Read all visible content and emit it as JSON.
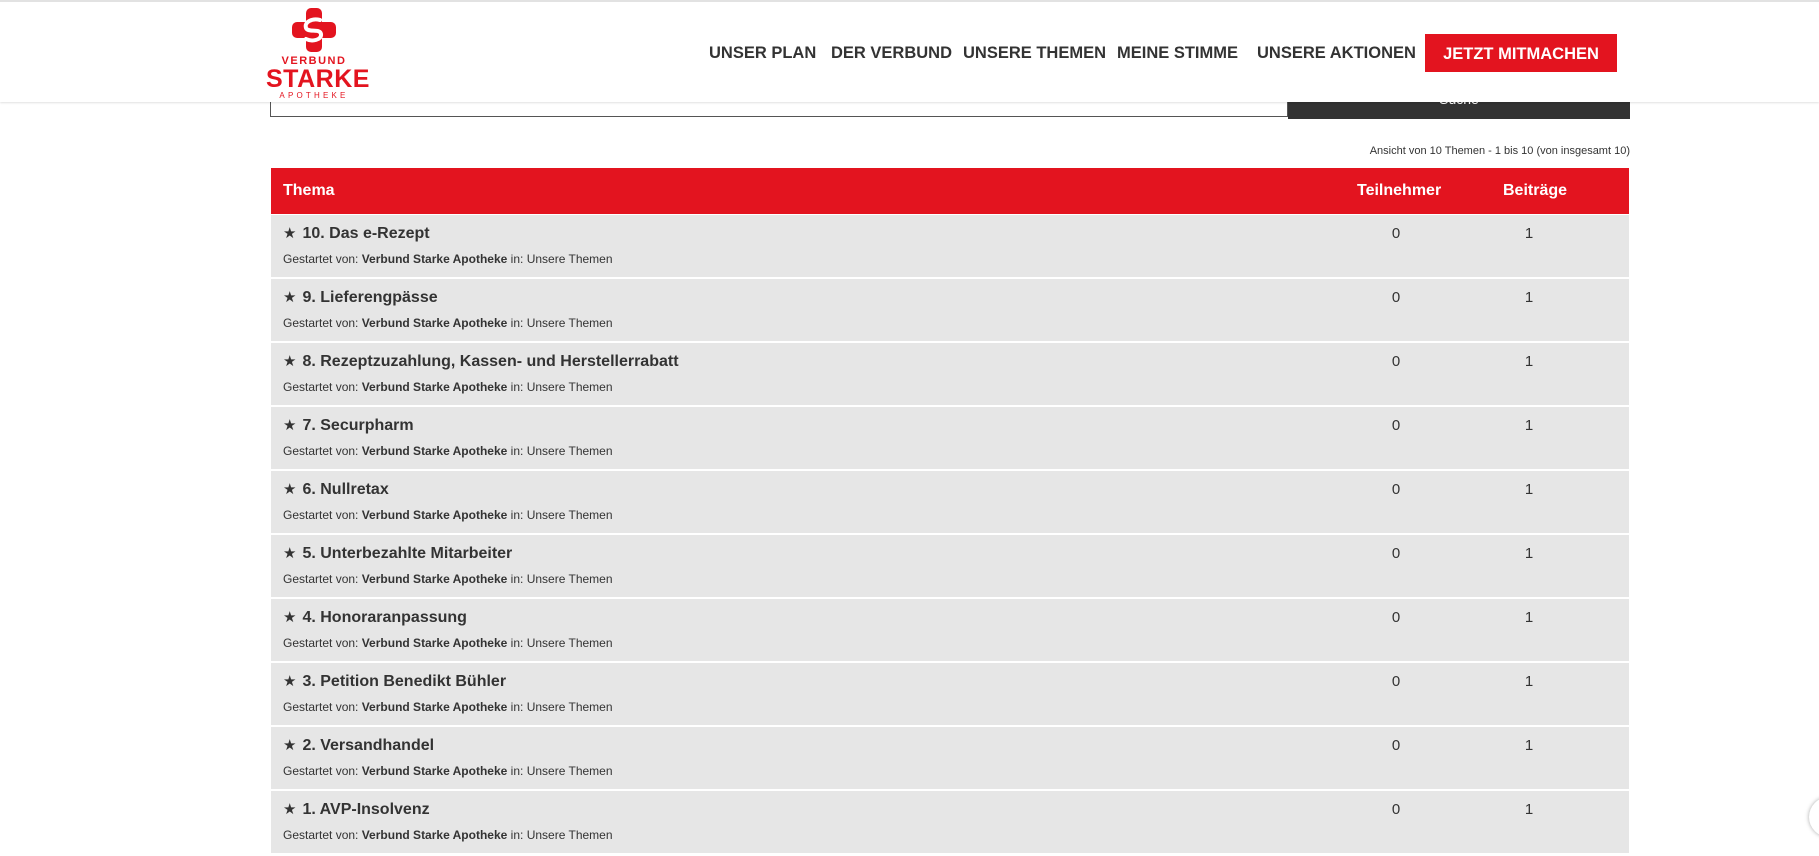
{
  "brand": {
    "line1": "VERBUND",
    "line2": "STARKE",
    "line3": "APOTHEKE",
    "color": "#e3141f"
  },
  "nav": {
    "items": [
      {
        "label": "UNSER PLAN"
      },
      {
        "label": "DER VERBUND"
      },
      {
        "label": "UNSERE THEMEN"
      },
      {
        "label": "MEINE STIMME"
      },
      {
        "label": "UNSERE AKTIONEN"
      }
    ],
    "cta_label": "JETZT MITMACHEN"
  },
  "search": {
    "button_label": "Suche"
  },
  "topics_summary": "Ansicht von 10 Themen - 1 bis 10 (von insgesamt 10)",
  "table": {
    "header": {
      "topic": "Thema",
      "participants": "Teilnehmer",
      "posts": "Beiträge"
    },
    "rows": [
      {
        "title": "10. Das e-Rezept",
        "started_by_label": "Gestartet von:",
        "author": "Verbund Starke Apotheke",
        "in_label": "in:",
        "forum": "Unsere Themen",
        "participants": "0",
        "posts": "1"
      },
      {
        "title": "9. Lieferengpässe",
        "started_by_label": "Gestartet von:",
        "author": "Verbund Starke Apotheke",
        "in_label": "in:",
        "forum": "Unsere Themen",
        "participants": "0",
        "posts": "1"
      },
      {
        "title": "8. Rezeptzuzahlung, Kassen- und Herstellerrabatt",
        "started_by_label": "Gestartet von:",
        "author": "Verbund Starke Apotheke",
        "in_label": "in:",
        "forum": "Unsere Themen",
        "participants": "0",
        "posts": "1"
      },
      {
        "title": "7. Securpharm",
        "started_by_label": "Gestartet von:",
        "author": "Verbund Starke Apotheke",
        "in_label": "in:",
        "forum": "Unsere Themen",
        "participants": "0",
        "posts": "1"
      },
      {
        "title": "6. Nullretax",
        "started_by_label": "Gestartet von:",
        "author": "Verbund Starke Apotheke",
        "in_label": "in:",
        "forum": "Unsere Themen",
        "participants": "0",
        "posts": "1"
      },
      {
        "title": "5. Unterbezahlte Mitarbeiter",
        "started_by_label": "Gestartet von:",
        "author": "Verbund Starke Apotheke",
        "in_label": "in:",
        "forum": "Unsere Themen",
        "participants": "0",
        "posts": "1"
      },
      {
        "title": "4. Honoraranpassung",
        "started_by_label": "Gestartet von:",
        "author": "Verbund Starke Apotheke",
        "in_label": "in:",
        "forum": "Unsere Themen",
        "participants": "0",
        "posts": "1"
      },
      {
        "title": "3. Petition Benedikt Bühler",
        "started_by_label": "Gestartet von:",
        "author": "Verbund Starke Apotheke",
        "in_label": "in:",
        "forum": "Unsere Themen",
        "participants": "0",
        "posts": "1"
      },
      {
        "title": "2. Versandhandel",
        "started_by_label": "Gestartet von:",
        "author": "Verbund Starke Apotheke",
        "in_label": "in:",
        "forum": "Unsere Themen",
        "participants": "0",
        "posts": "1"
      },
      {
        "title": "1. AVP-Insolvenz",
        "started_by_label": "Gestartet von:",
        "author": "Verbund Starke Apotheke",
        "in_label": "in:",
        "forum": "Unsere Themen",
        "participants": "0",
        "posts": "1"
      }
    ]
  },
  "icons": {
    "row_marker": "star-icon",
    "logo": "cross-logo-icon"
  },
  "colors": {
    "accent": "#e3141f",
    "row_background": "#e6e6e6",
    "text": "#333333",
    "search_button": "#333333"
  }
}
